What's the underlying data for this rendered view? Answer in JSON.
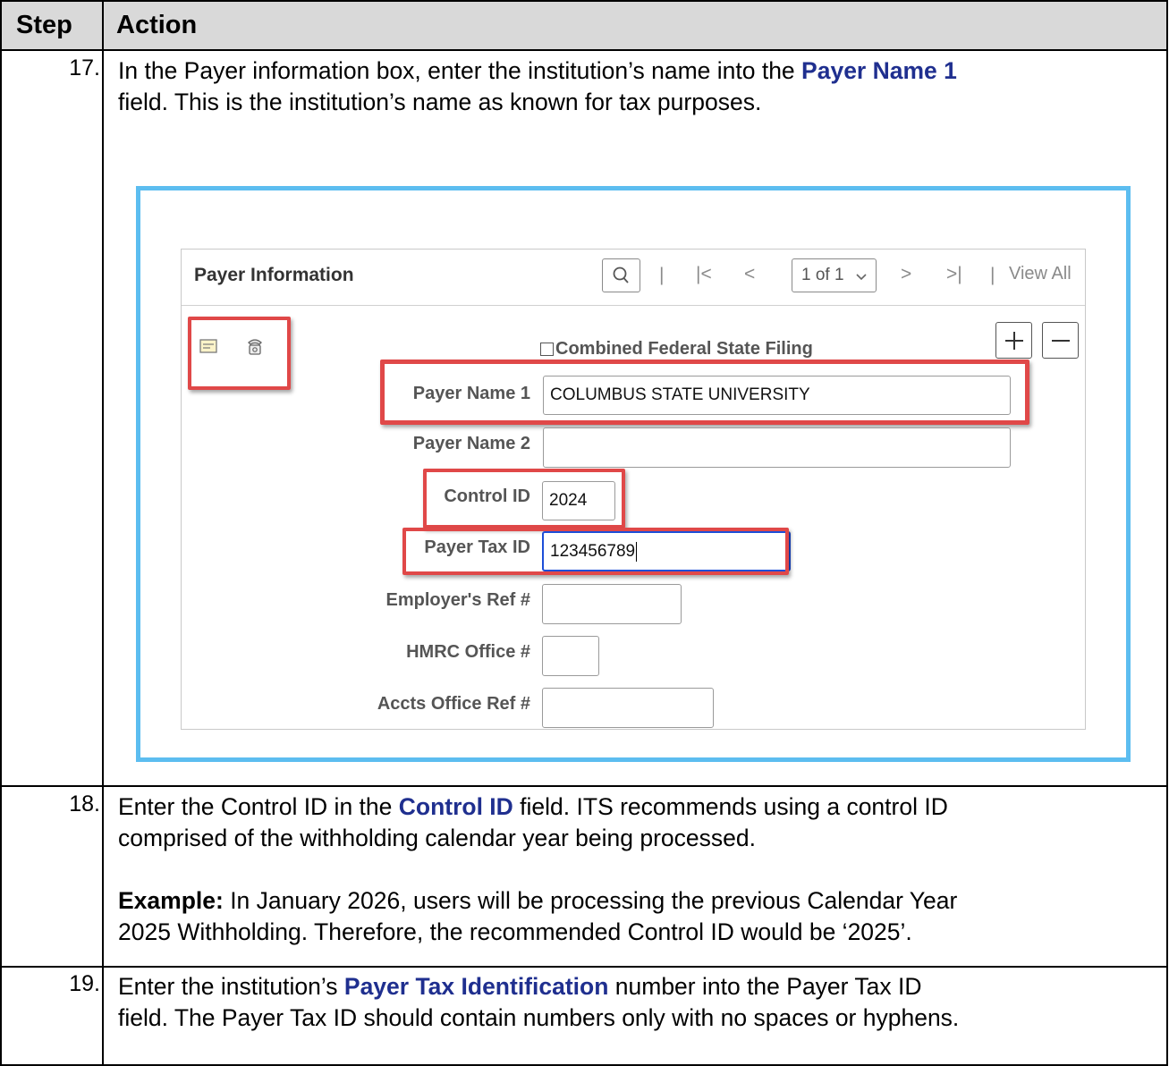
{
  "table": {
    "header": {
      "step": "Step",
      "action": "Action"
    },
    "rows": [
      {
        "step": "17.",
        "lines": [
          {
            "t1": "In the Payer information box, enter the institution’s name into the ",
            "hl": "Payer Name 1"
          },
          {
            "t1": "field. This is the institution’s name as known for tax purposes."
          }
        ]
      },
      {
        "step": "18.",
        "line1_a": "Enter the Control ID in the ",
        "line1_hl": "Control ID",
        "line1_b": " field. ITS recommends using a control ID",
        "line2": "comprised of the withholding calendar year being processed.",
        "example_label": "Example:",
        "example_a": " In January 2026, users will be processing the previous Calendar Year",
        "example_b": "2025 Withholding. Therefore, the recommended Control ID would be ‘2025’."
      },
      {
        "step": "19.",
        "line1_a": "Enter the institution’s ",
        "line1_hl": "Payer Tax Identification",
        "line1_b": " number into the Payer Tax ID",
        "line2": "field. The Payer Tax ID should contain numbers only with no spaces or hyphens."
      }
    ]
  },
  "screenshot": {
    "panel_title": "Payer Information",
    "nav": {
      "separator": "|",
      "first": "|<",
      "prev": "<",
      "page_select": "1 of 1",
      "next": ">",
      "last": ">|",
      "view_all": "View All"
    },
    "checkbox_label": "Combined Federal State Filing",
    "fields": {
      "payer_name_1": {
        "label": "Payer Name 1",
        "value": "COLUMBUS STATE UNIVERSITY"
      },
      "payer_name_2": {
        "label": "Payer Name 2",
        "value": ""
      },
      "control_id": {
        "label": "Control ID",
        "value": "2024"
      },
      "payer_tax_id": {
        "label": "Payer Tax ID",
        "value": "123456789"
      },
      "employers_ref": {
        "label": "Employer's Ref #",
        "value": ""
      },
      "hmrc_office": {
        "label": "HMRC Office #",
        "value": ""
      },
      "accts_office_ref": {
        "label": "Accts Office Ref #",
        "value": ""
      }
    },
    "icons": [
      "envelope-icon",
      "phone-icon"
    ],
    "highlight_color": "#e04848",
    "frame_color": "#5cbdf0"
  }
}
